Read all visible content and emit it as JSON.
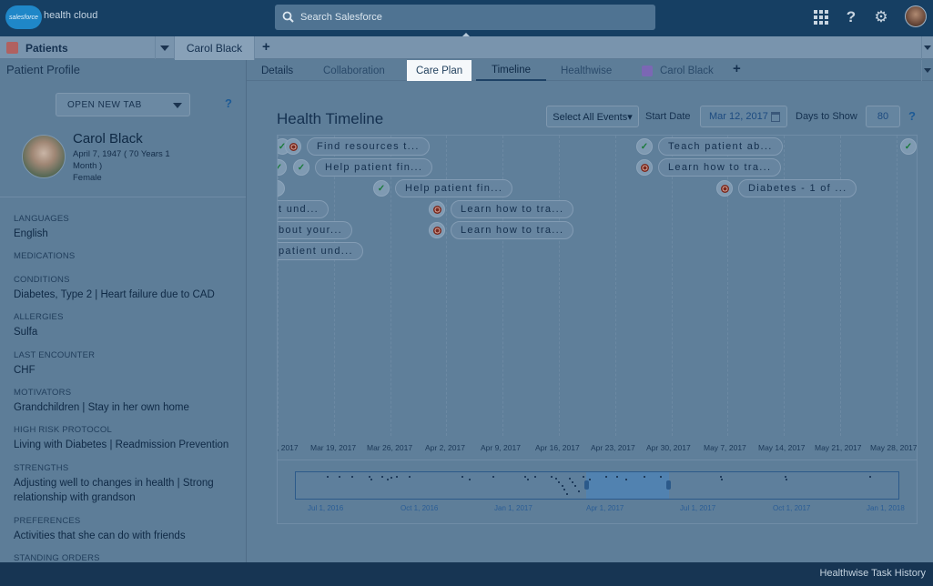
{
  "header": {
    "logo_text": "salesforce",
    "app_name": "health cloud",
    "search_placeholder": "Search Salesforce"
  },
  "tabstrip": {
    "app_label": "Patients",
    "tab_label": "Carol Black"
  },
  "left_panel": {
    "title": "Patient Profile",
    "open_tab_label": "OPEN NEW TAB",
    "help": "?",
    "patient": {
      "name": "Carol Black",
      "dob_line1": "April 7, 1947 ( 70 Years 1",
      "dob_line2": "Month )",
      "gender": "Female"
    },
    "fields": [
      {
        "label": "LANGUAGES",
        "value": "English"
      },
      {
        "label": "MEDICATIONS",
        "value": ""
      },
      {
        "label": "CONDITIONS",
        "value": "Diabetes, Type 2 | Heart failure due to CAD"
      },
      {
        "label": "ALLERGIES",
        "value": "Sulfa"
      },
      {
        "label": "LAST ENCOUNTER",
        "value": "CHF"
      },
      {
        "label": "MOTIVATORS",
        "value": "Grandchildren | Stay in her own home"
      },
      {
        "label": "HIGH RISK PROTOCOL",
        "value": "Living with Diabetes | Readmission Prevention"
      },
      {
        "label": "STRENGTHS",
        "value": "Adjusting well to changes in health | Strong relationship with grandson"
      },
      {
        "label": "PREFERENCES",
        "value": "Activities that she can do with friends"
      },
      {
        "label": "STANDING ORDERS",
        "value": ""
      }
    ]
  },
  "subtabs": [
    {
      "label": "Details"
    },
    {
      "label": "Collaboration"
    },
    {
      "label": "Care Plan"
    },
    {
      "label": "Timeline"
    },
    {
      "label": "Healthwise"
    },
    {
      "label": "Carol Black"
    }
  ],
  "timeline": {
    "title": "Health Timeline",
    "select_all": "Select All Events▾",
    "start_date_label": "Start Date",
    "start_date_value": "Mar 12, 2017",
    "days_label": "Days to Show",
    "days_value": "80",
    "help": "?",
    "events": [
      {
        "icon": "target",
        "text": "Find resources t..."
      },
      {
        "icon": "check",
        "text": "Help patient fin..."
      },
      {
        "icon": "check",
        "text": "Help patient fin..."
      },
      {
        "icon": "none",
        "text": "t und..."
      },
      {
        "icon": "none",
        "text": "bout your..."
      },
      {
        "icon": "none",
        "text": "patient und..."
      },
      {
        "icon": "target",
        "text": "Learn how to tra..."
      },
      {
        "icon": "target",
        "text": "Learn how to tra..."
      },
      {
        "icon": "check",
        "text": "Teach patient ab..."
      },
      {
        "icon": "target",
        "text": "Learn how to tra..."
      },
      {
        "icon": "target",
        "text": "Diabetes - 1 of ..."
      },
      {
        "icon": "check",
        "text": ""
      }
    ],
    "axis_ticks": [
      ", 2017",
      "Mar 19, 2017",
      "Mar 26, 2017",
      "Apr 2, 2017",
      "Apr 9, 2017",
      "Apr 16, 2017",
      "Apr 23, 2017",
      "Apr 30, 2017",
      "May 7, 2017",
      "May 14, 2017",
      "May 21, 2017",
      "May 28, 2017"
    ],
    "overview_ticks": [
      "Jul 1, 2016",
      "Oct 1, 2016",
      "Jan 1, 2017",
      "Apr 1, 2017",
      "Jul 1, 2017",
      "Oct 1, 2017",
      "Jan 1, 2018"
    ]
  },
  "footer": {
    "utility_label": "Healthwise Task History"
  },
  "colors": {
    "header": "#163f63",
    "overlay": "#5d7d98",
    "accent": "#1c5a96"
  }
}
